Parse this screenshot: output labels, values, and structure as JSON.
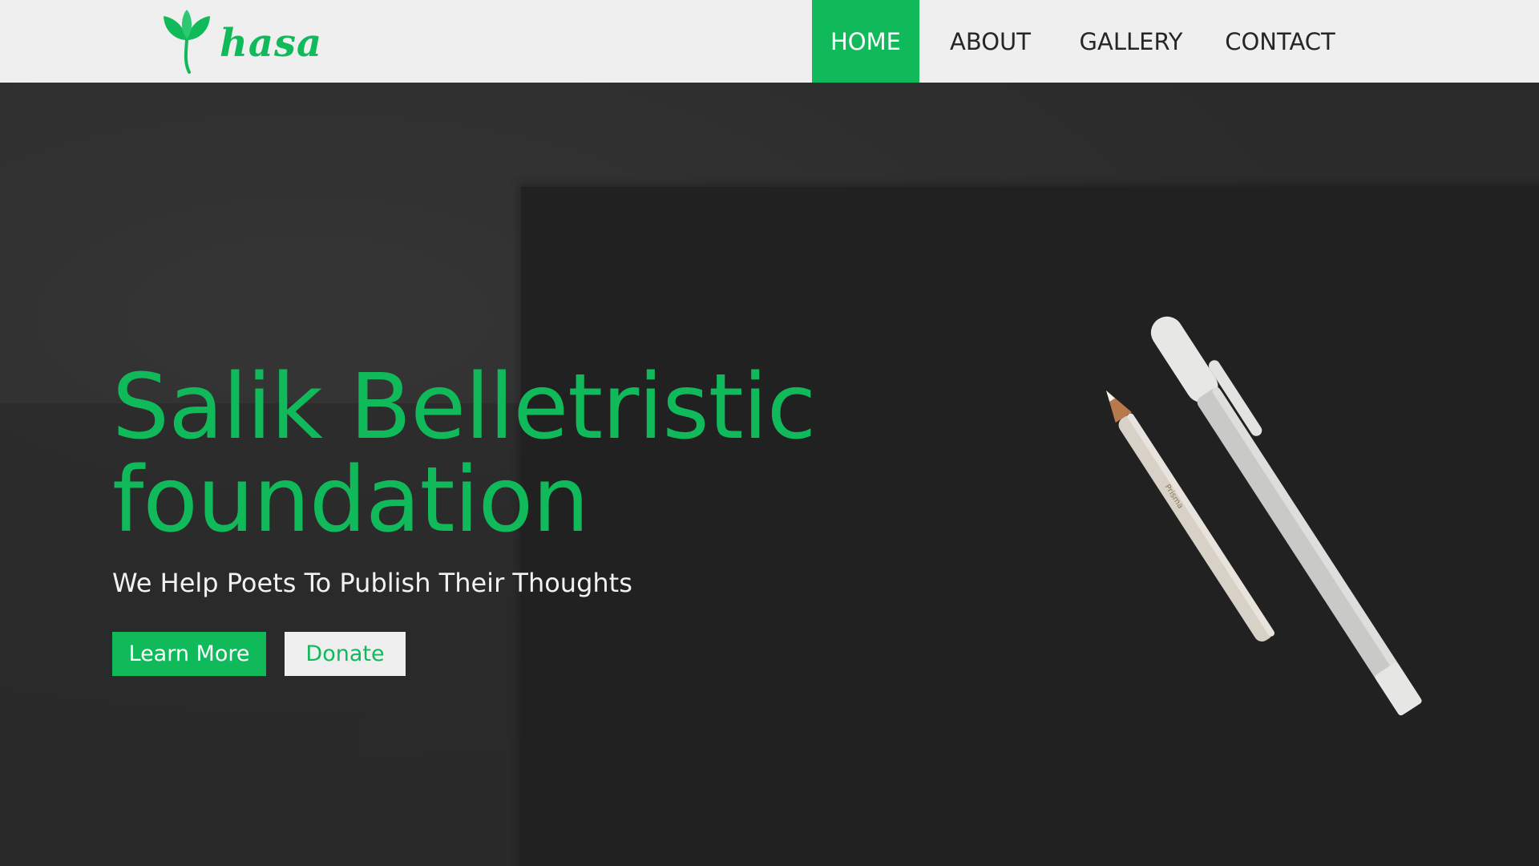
{
  "colors": {
    "accent": "#10b95a",
    "header_bg": "#efefef",
    "hero_bg": "#2b2b2b"
  },
  "header": {
    "logo_text": "hasa",
    "logo_icon": "leaf-sprout-icon",
    "nav": [
      {
        "label": "HOME",
        "active": true
      },
      {
        "label": "ABOUT",
        "active": false
      },
      {
        "label": "GALLERY",
        "active": false
      },
      {
        "label": "CONTACT",
        "active": false
      }
    ]
  },
  "hero": {
    "title": "Salik Belletristic foundation",
    "subtitle": "We Help Poets To Publish Their Thoughts",
    "buttons": {
      "primary": "Learn More",
      "secondary": "Donate"
    }
  }
}
